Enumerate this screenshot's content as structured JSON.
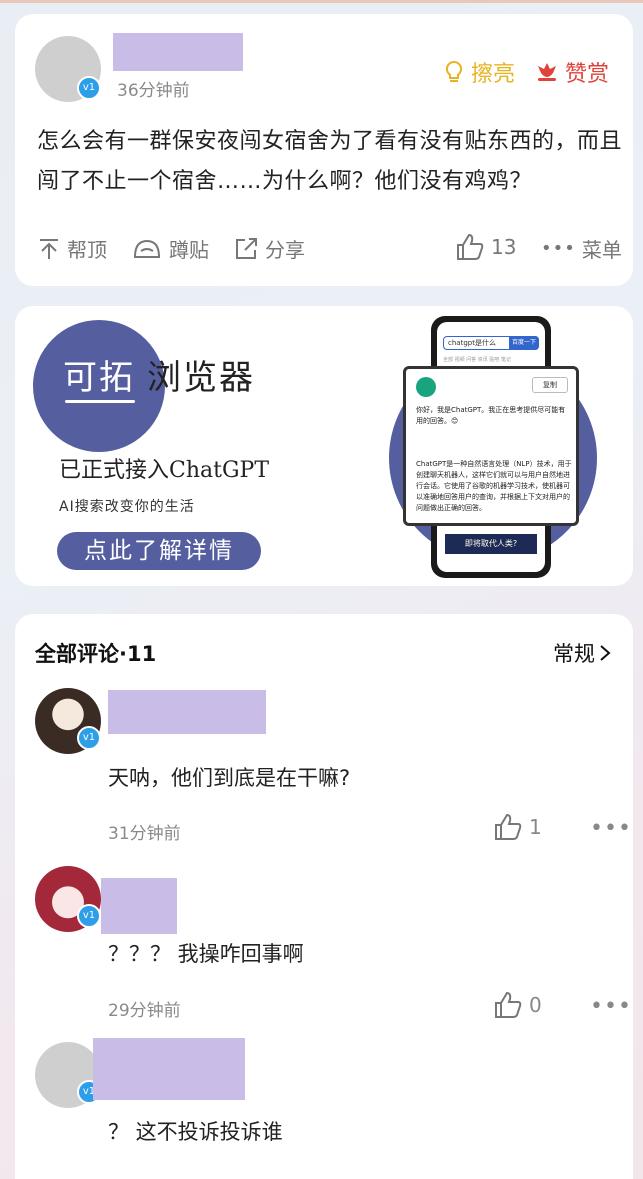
{
  "post": {
    "time": "36分钟前",
    "badge": "v1",
    "actions": {
      "polish": "擦亮",
      "reward": "赞赏"
    },
    "text": "怎么会有一群保安夜闯女宿舍为了看有没有贴东西的，而且闯了不止一个宿舍……为什么啊？他们没有鸡鸡？",
    "footer": {
      "top": "帮顶",
      "squat": "蹲贴",
      "share": "分享",
      "likes": "13",
      "menu": "菜单"
    }
  },
  "ad": {
    "logo_text": "可拓",
    "title": "浏览器",
    "sub1": "已正式接入ChatGPT",
    "sub2": "AI搜索改变你的生活",
    "button": "点此了解详情",
    "phone": {
      "search_text": "chatgpt是什么",
      "search_button": "百度一下",
      "tabs": "全部  视频  问答  资讯  贴吧  笔记",
      "copy": "复制",
      "p1": "你好，我是ChatGPT。我正在思考提供尽可能有用的回答。😊",
      "p2": "ChatGPT是一种自然语言处理（NLP）技术，用于创建聊天机器人，这样它们就可以与用户自然地进行会话。它使用了谷歌的机器学习技术，使机器可以准确地回答用户的查询，并根据上下文对用户的问题做出正确的回答。",
      "banner": "即将取代人类?"
    }
  },
  "comments": {
    "header": "全部评论·11",
    "sort": "常规",
    "items": [
      {
        "text": "天呐，他们到底是在干嘛?",
        "time": "31分钟前",
        "likes": "1"
      },
      {
        "text": "？？？ 我操咋回事啊",
        "time": "29分钟前",
        "likes": "0"
      },
      {
        "text": "？ 这不投诉投诉谁",
        "time": "",
        "likes": ""
      }
    ]
  },
  "colors": {
    "accent_yellow": "#e8b320",
    "accent_red": "#e0433b",
    "ad_purple": "#555fa0",
    "badge_blue": "#2d9ee8",
    "name_mask": "#c9bde8"
  }
}
